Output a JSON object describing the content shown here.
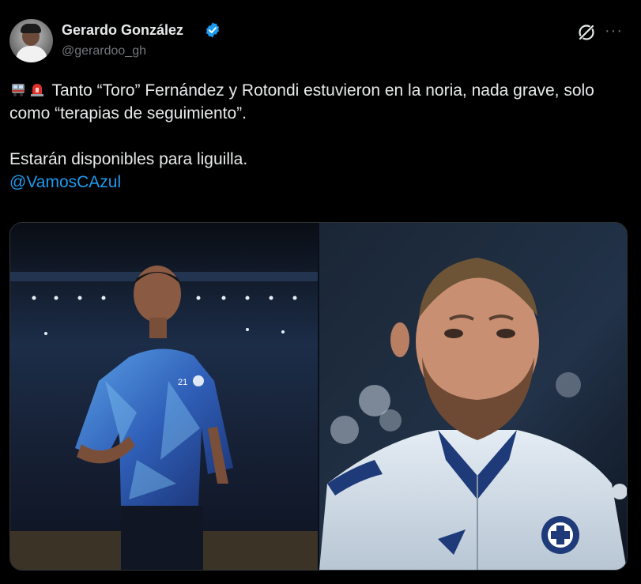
{
  "author": {
    "display_name": "Gerardo González",
    "handle": "@gerardoo_gh"
  },
  "icons": {
    "verified": "verified-badge-icon",
    "grok": "grok-icon",
    "more": "more-icon"
  },
  "tweet": {
    "line1": "Tanto “Toro” Fernández y Rotondi estuvieron en la noria, nada grave, solo como “terapias de seguimiento”.",
    "line2": "Estarán disponibles para liguilla.",
    "mention": "@VamosCAzul"
  },
  "media": {
    "left_jersey_number": "21"
  },
  "colors": {
    "background": "#000000",
    "text": "#e7e9ea",
    "muted": "#71767b",
    "link": "#1d9bf0",
    "verified": "#1d9bf0"
  }
}
